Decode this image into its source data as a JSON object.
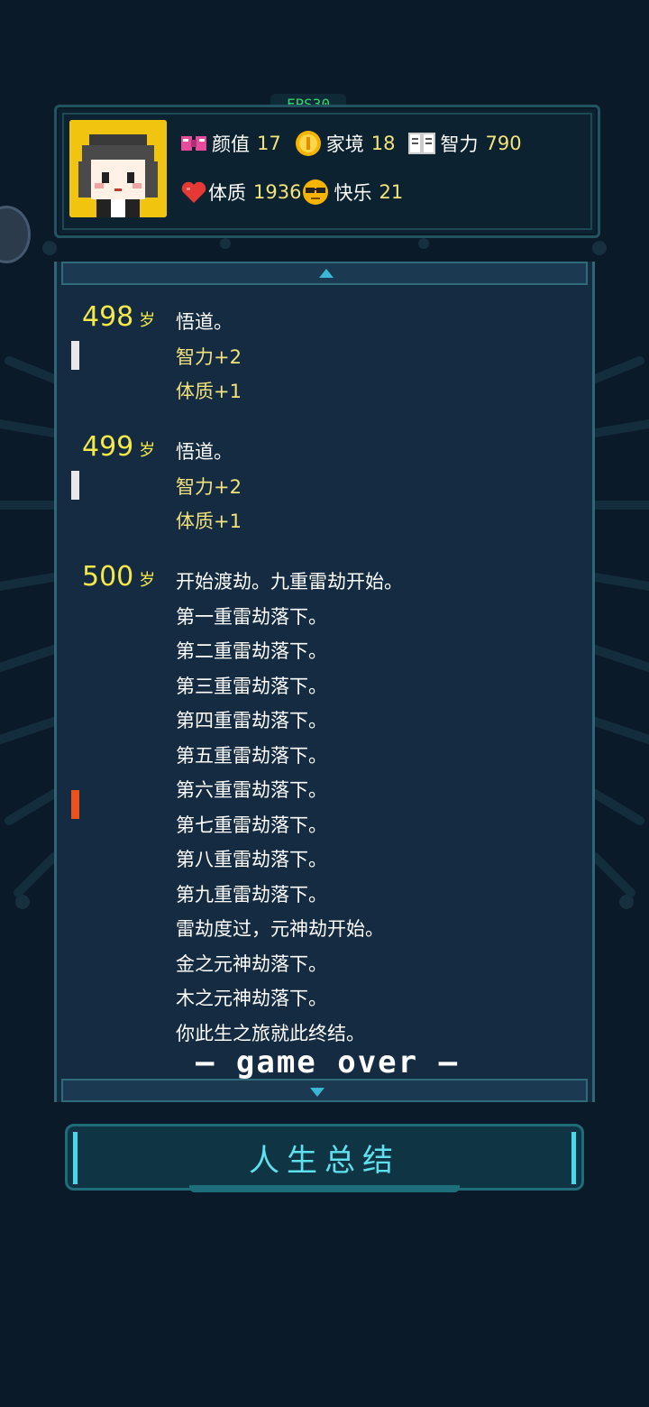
{
  "fps": "FPS30",
  "stats": {
    "appearance": {
      "label": "颜值",
      "value": "17",
      "icon": "bow-icon"
    },
    "family": {
      "label": "家境",
      "value": "18",
      "icon": "coin-icon"
    },
    "intellect": {
      "label": "智力",
      "value": "790",
      "icon": "book-icon"
    },
    "physique": {
      "label": "体质",
      "value": "1936",
      "icon": "heart-icon"
    },
    "happiness": {
      "label": "快乐",
      "value": "21",
      "icon": "sunglasses-face-icon"
    }
  },
  "log": {
    "entries": [
      {
        "age": "498",
        "unit": "岁",
        "lines": [
          "悟道。"
        ],
        "changes": [
          "智力+2",
          "体质+1"
        ]
      },
      {
        "age": "499",
        "unit": "岁",
        "lines": [
          "悟道。"
        ],
        "changes": [
          "智力+2",
          "体质+1"
        ]
      },
      {
        "age": "500",
        "unit": "岁",
        "lines": [
          "开始渡劫。九重雷劫开始。",
          "第一重雷劫落下。",
          "第二重雷劫落下。",
          "第三重雷劫落下。",
          "第四重雷劫落下。",
          "第五重雷劫落下。",
          "第六重雷劫落下。",
          "第七重雷劫落下。",
          "第八重雷劫落下。",
          "第九重雷劫落下。",
          "雷劫度过，元神劫开始。",
          "金之元神劫落下。",
          "木之元神劫落下。",
          "你此生之旅就此终结。"
        ],
        "changes": []
      }
    ],
    "game_over": "— game over —"
  },
  "summary_button": "人生总结",
  "colors": {
    "accent": "#5fe0ef",
    "age": "#f4e84a",
    "change": "#f2e37c",
    "marker_white": "#e8e8e8",
    "marker_orange": "#e8541b"
  }
}
